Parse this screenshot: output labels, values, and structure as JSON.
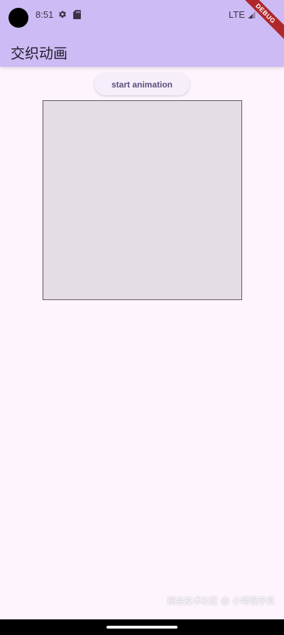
{
  "status_bar": {
    "time": "8:51",
    "network": "LTE",
    "icons": [
      "camera-cutout",
      "gear-icon",
      "sd-card-icon",
      "signal-icon"
    ]
  },
  "debug_banner": {
    "label": "DEBUG",
    "color": "#b0282b"
  },
  "app_bar": {
    "title": "交织动画",
    "color": "#cdbbf5"
  },
  "main": {
    "start_button_label": "start animation",
    "box_color": "#e5dde6"
  },
  "watermark": {
    "text": "掘金技术社区 @ 小墙程序员"
  },
  "colors": {
    "background": "#fdf4fd",
    "accent": "#5b4f7a"
  }
}
